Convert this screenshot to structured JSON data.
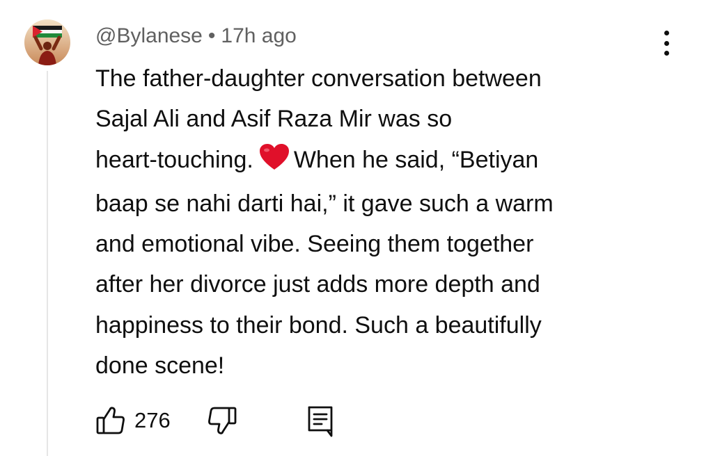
{
  "comment": {
    "username": "@Bylanese",
    "separator": "•",
    "timestamp": "17h ago",
    "text_lines": [
      "The father-daughter conversation between",
      "Sajal Ali and Asif Raza Mir was so",
      [
        "heart-touching.",
        "When he said, “Betiyan"
      ],
      "baap se nahi darti hai,” it gave such a warm",
      "and emotional vibe. Seeing them together",
      "after her divorce just adds more depth and",
      "happiness to their bond. Such a beautifully",
      "done scene!"
    ],
    "emoji": "red-heart",
    "like_count": "276"
  },
  "icons": {
    "like": "thumbs-up-icon",
    "dislike": "thumbs-down-icon",
    "reply": "comment-reply-icon",
    "more": "more-vert-icon"
  },
  "colors": {
    "text": "#0f0f0f",
    "secondary_text": "#606060",
    "heart": "#e0102a",
    "thread_line": "#e6e6e6"
  }
}
